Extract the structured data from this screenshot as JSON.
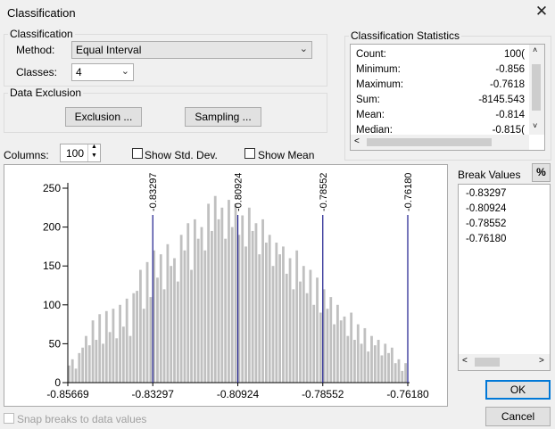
{
  "window": {
    "title": "Classification",
    "close_glyph": "✕"
  },
  "classification": {
    "group_label": "Classification",
    "method_label": "Method:",
    "method_value": "Equal Interval",
    "classes_label": "Classes:",
    "classes_value": "4"
  },
  "data_exclusion": {
    "group_label": "Data Exclusion",
    "exclusion_button": "Exclusion ...",
    "sampling_button": "Sampling ..."
  },
  "statistics": {
    "group_label": "Classification Statistics",
    "rows": [
      {
        "label": "Count:",
        "value": "100("
      },
      {
        "label": "Minimum:",
        "value": "-0.856"
      },
      {
        "label": "Maximum:",
        "value": "-0.7618"
      },
      {
        "label": "Sum:",
        "value": "-8145.543"
      },
      {
        "label": "Mean:",
        "value": "-0.814"
      },
      {
        "label": "Median:",
        "value": "-0.815("
      }
    ]
  },
  "columns": {
    "label": "Columns:",
    "value": "100"
  },
  "show_std_dev": {
    "label": "Show Std. Dev.",
    "checked": false
  },
  "show_mean": {
    "label": "Show Mean",
    "checked": false
  },
  "break_values": {
    "label": "Break Values",
    "percent_button": "%",
    "values": [
      "-0.83297",
      "-0.80924",
      "-0.78552",
      "-0.76180"
    ]
  },
  "snap_breaks": {
    "label": "Snap breaks to data values",
    "checked": false
  },
  "buttons": {
    "ok": "OK",
    "cancel": "Cancel"
  },
  "chart_data": {
    "type": "bar",
    "x_min": -0.85669,
    "x_max": -0.7618,
    "x_tick_labels": [
      "-0.85669",
      "-0.83297",
      "-0.80924",
      "-0.78552",
      "-0.76180"
    ],
    "ylim": [
      0,
      250
    ],
    "y_ticks": [
      0,
      50,
      100,
      150,
      200,
      250
    ],
    "y_tick_labels": [
      "0",
      "50",
      "100",
      "150",
      "200",
      "250"
    ],
    "break_values": [
      -0.83297,
      -0.80924,
      -0.78552,
      -0.7618
    ],
    "break_labels": [
      "-0.83297",
      "-0.80924",
      "-0.78552",
      "-0.76180"
    ],
    "bar_color": "#c0c0c0",
    "break_line_color": "#1c1c8c",
    "values": [
      22,
      30,
      18,
      38,
      45,
      60,
      48,
      80,
      55,
      88,
      50,
      92,
      65,
      95,
      57,
      100,
      72,
      108,
      60,
      115,
      118,
      145,
      95,
      155,
      110,
      170,
      135,
      165,
      120,
      178,
      150,
      160,
      130,
      190,
      170,
      205,
      145,
      210,
      185,
      200,
      170,
      230,
      195,
      240,
      210,
      225,
      185,
      235,
      200,
      230,
      190,
      215,
      175,
      225,
      195,
      205,
      165,
      210,
      180,
      190,
      150,
      180,
      165,
      175,
      140,
      160,
      120,
      170,
      130,
      150,
      115,
      145,
      100,
      135,
      90,
      120,
      95,
      110,
      75,
      100,
      80,
      85,
      60,
      90,
      55,
      75,
      50,
      70,
      40,
      60,
      48,
      55,
      35,
      50,
      38,
      45,
      25,
      30,
      15,
      25
    ]
  }
}
